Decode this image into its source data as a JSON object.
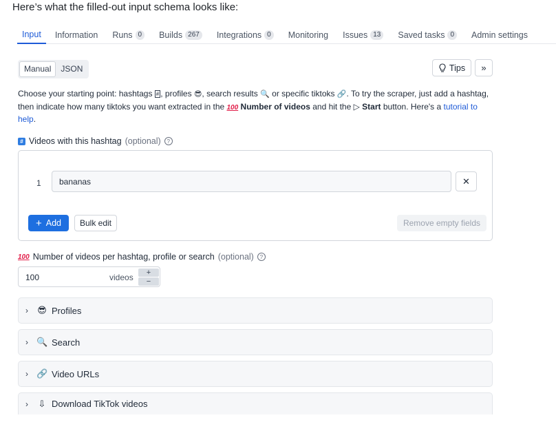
{
  "intro": "Here’s what the filled-out input schema looks like:",
  "tabs": [
    {
      "label": "Input",
      "badge": null
    },
    {
      "label": "Information",
      "badge": null
    },
    {
      "label": "Runs",
      "badge": "0"
    },
    {
      "label": "Builds",
      "badge": "267"
    },
    {
      "label": "Integrations",
      "badge": "0"
    },
    {
      "label": "Monitoring",
      "badge": null
    },
    {
      "label": "Issues",
      "badge": "13"
    },
    {
      "label": "Saved tasks",
      "badge": "0"
    },
    {
      "label": "Admin settings",
      "badge": null
    }
  ],
  "mode": {
    "manual": "Manual",
    "json": "JSON"
  },
  "tips": "Tips",
  "description": {
    "p1": "Choose your starting point: hashtags ",
    "p2": ", profiles ",
    "p3": ", search results ",
    "p4": " or specific tiktoks ",
    "p5": ". To try the scraper, just add a hashtag, then indicate how many tiktoks you want extracted in the ",
    "bold1": "Number of videos",
    "p6": " and hit the ▷ ",
    "bold2": "Start",
    "p7": " button. Here's a ",
    "link": "tutorial to help",
    "p8": "."
  },
  "hashtags_field": {
    "label": "Videos with this hashtag",
    "optional": "(optional)",
    "rows": [
      {
        "index": "1",
        "value": "bananas"
      }
    ],
    "add": "Add",
    "bulk_edit": "Bulk edit",
    "remove_empty": "Remove empty fields"
  },
  "videos_field": {
    "label": "Number of videos per hashtag, profile or search",
    "optional": "(optional)",
    "value": "100",
    "unit": "videos"
  },
  "sections": [
    {
      "label": "Profiles",
      "icon": "sunglasses-emoji-icon"
    },
    {
      "label": "Search",
      "icon": "magnifier-emoji-icon"
    },
    {
      "label": "Video URLs",
      "icon": "link-icon"
    },
    {
      "label": "Download TikTok videos",
      "icon": "download-video-icon"
    }
  ]
}
